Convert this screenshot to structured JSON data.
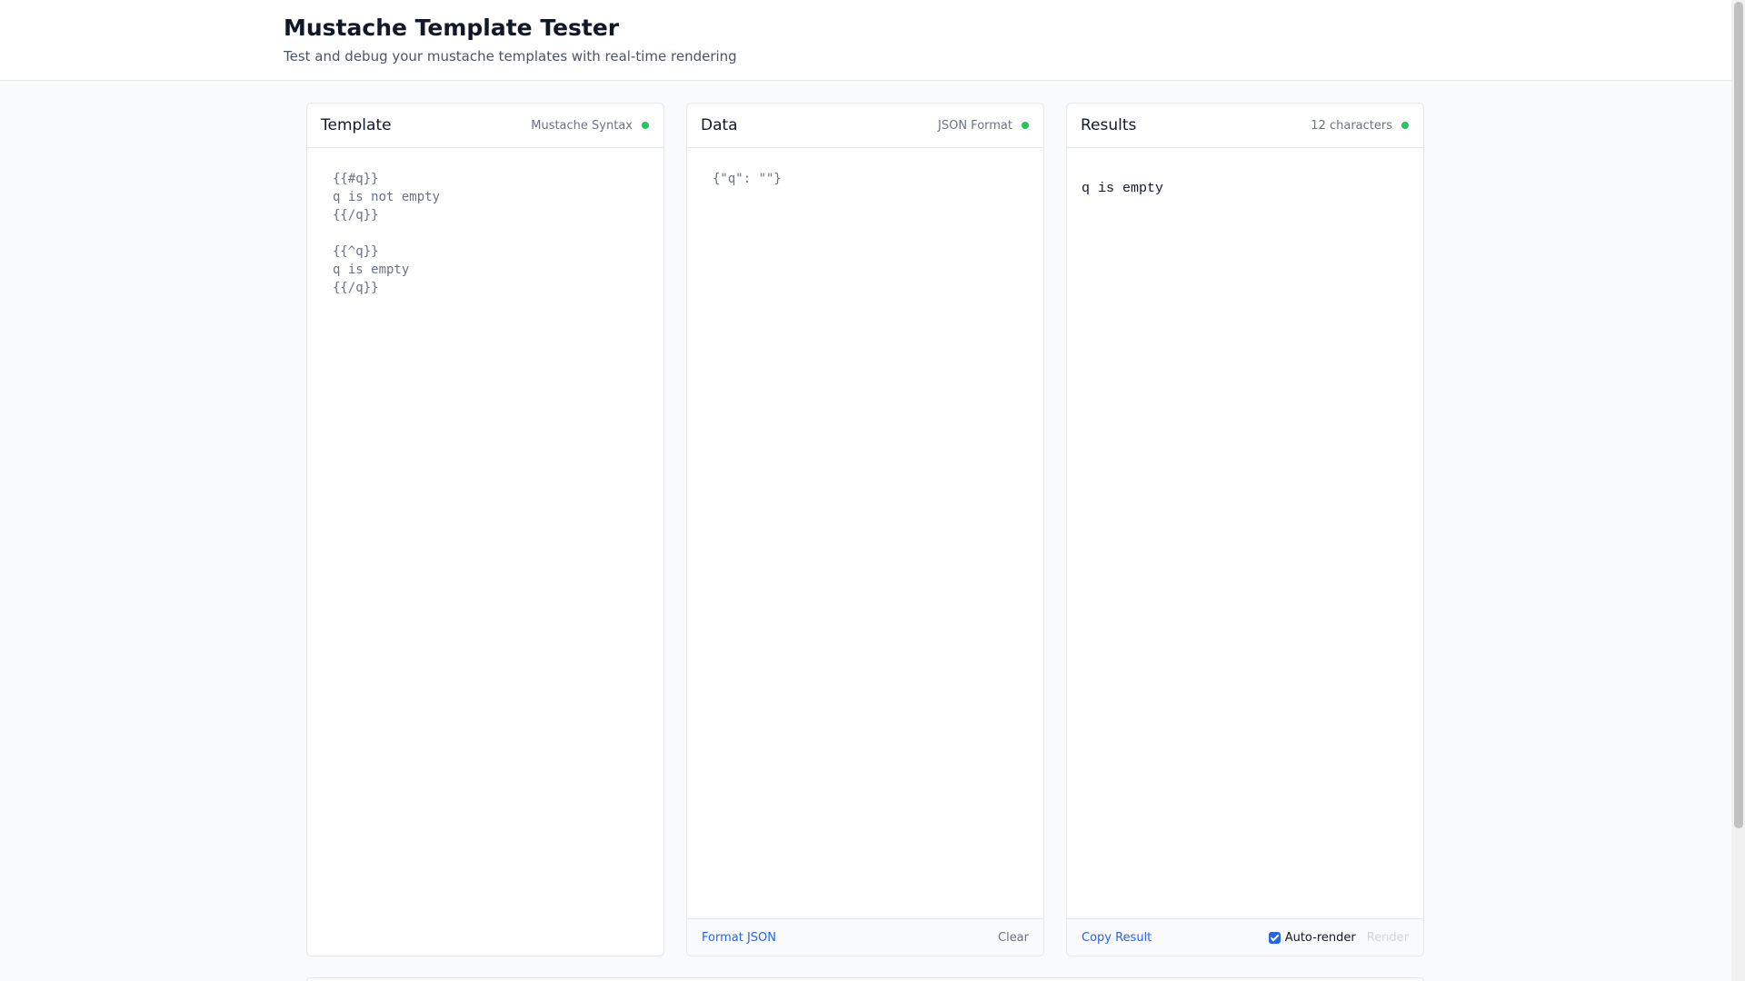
{
  "header": {
    "title": "Mustache Template Tester",
    "subtitle": "Test and debug your mustache templates with real-time rendering"
  },
  "template_panel": {
    "title": "Template",
    "status": "Mustache Syntax",
    "status_color": "#22c55e",
    "content": "{{#q}}\nq is not empty\n{{/q}}\n\n{{^q}}\nq is empty\n{{/q}}"
  },
  "data_panel": {
    "title": "Data",
    "status": "JSON Format",
    "status_color": "#22c55e",
    "content": "{\"q\": \"\"}",
    "format_label": "Format JSON",
    "clear_label": "Clear"
  },
  "results_panel": {
    "title": "Results",
    "status": "12 characters",
    "status_color": "#22c55e",
    "content": "q is empty",
    "copy_label": "Copy Result",
    "autorender_label": "Auto-render",
    "autorender_checked": true,
    "render_label": "Render"
  },
  "colors": {
    "accent": "#2563eb",
    "ok": "#22c55e"
  }
}
